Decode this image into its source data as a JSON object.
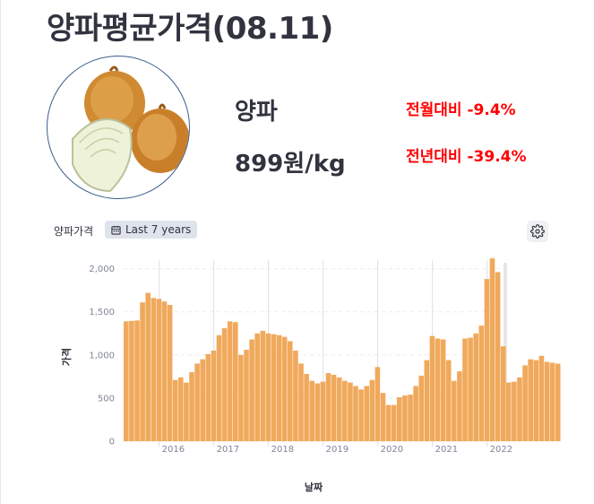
{
  "page": {
    "title": "양파평균가격(08.11)"
  },
  "product": {
    "name": "양파",
    "price": "899원/kg",
    "mom_change": "전월대비 -9.4%",
    "yoy_change": "전년대비 -39.4%",
    "change_color": "#ff0000",
    "image_icon": "onion-photo"
  },
  "controls": {
    "chart_label": "양파가격",
    "range_label": "Last 7 years",
    "calendar_icon": "calendar-icon",
    "settings_icon": "gear-icon"
  },
  "chart_data": {
    "type": "bar",
    "bar_color": "#f0a95c",
    "xlabel": "날짜",
    "ylabel": "가격",
    "ylim": [
      0,
      2100
    ],
    "yticks": [
      0,
      500,
      1000,
      1500,
      2000
    ],
    "ytick_labels": [
      "0",
      "500",
      "1,000",
      "1,500",
      "2,000"
    ],
    "xticks": [
      {
        "label": "2016",
        "index": 6.5
      },
      {
        "label": "2017",
        "index": 16.5
      },
      {
        "label": "2018",
        "index": 26.5
      },
      {
        "label": "2019",
        "index": 36.5
      },
      {
        "label": "2020",
        "index": 46.5
      },
      {
        "label": "2021",
        "index": 56.5
      },
      {
        "label": "2022",
        "index": 66.5
      }
    ],
    "values": [
      1390,
      1395,
      1400,
      1610,
      1720,
      1660,
      1650,
      1620,
      1580,
      710,
      740,
      680,
      800,
      900,
      950,
      1010,
      1050,
      1230,
      1310,
      1390,
      1380,
      1000,
      1060,
      1180,
      1250,
      1280,
      1250,
      1240,
      1230,
      1210,
      1160,
      1050,
      900,
      780,
      700,
      670,
      690,
      790,
      770,
      740,
      700,
      680,
      640,
      600,
      640,
      710,
      860,
      560,
      420,
      420,
      510,
      530,
      540,
      640,
      760,
      940,
      1220,
      1190,
      1180,
      940,
      700,
      810,
      1190,
      1200,
      1250,
      1340,
      1880,
      2120,
      1960,
      1100,
      680,
      690,
      740,
      880,
      950,
      940,
      990,
      920,
      910,
      899
    ]
  }
}
